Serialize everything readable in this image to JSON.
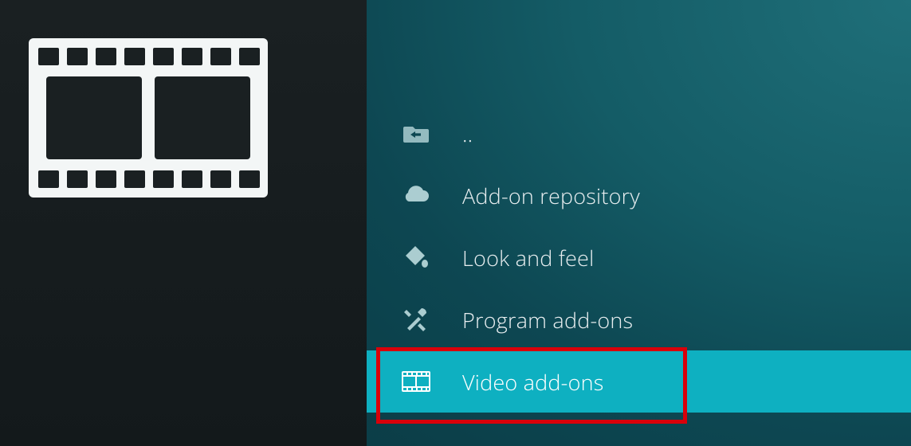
{
  "list": {
    "items": [
      {
        "label": ".."
      },
      {
        "label": "Add-on repository"
      },
      {
        "label": "Look and feel"
      },
      {
        "label": "Program add-ons"
      },
      {
        "label": "Video add-ons"
      }
    ]
  }
}
